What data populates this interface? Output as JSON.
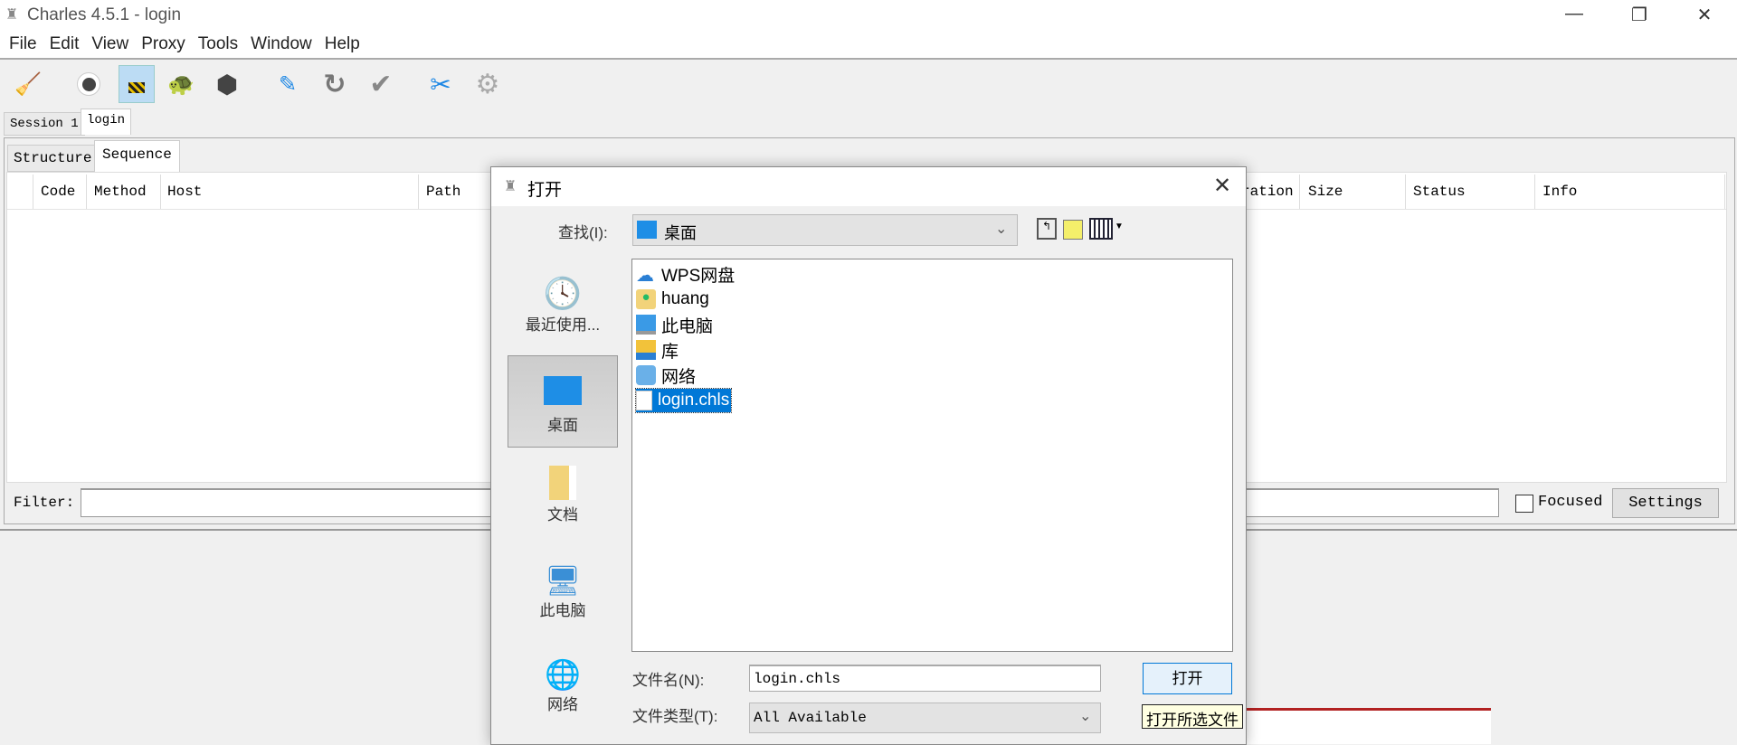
{
  "window": {
    "title": "Charles 4.5.1 - login",
    "minimize": "—",
    "maximize": "❐",
    "close": "✕"
  },
  "menu": [
    "File",
    "Edit",
    "View",
    "Proxy",
    "Tools",
    "Window",
    "Help"
  ],
  "toolbar": [
    "broom-icon",
    "record-icon",
    "ssl-lock-icon",
    "throttle-turtle-icon",
    "stop-hexagon-icon",
    "compose-pen-icon",
    "repeat-icon",
    "validate-check-icon",
    "tools-icon",
    "settings-gear-icon"
  ],
  "session_tabs": [
    "Session 1",
    "login"
  ],
  "view_tabs": [
    "Structure",
    "Sequence"
  ],
  "columns": [
    "Code",
    "Method",
    "Host",
    "Path",
    "ration",
    "Size",
    "Status",
    "Info"
  ],
  "filter": {
    "label": "Filter:",
    "value": "",
    "focused_label": "Focused",
    "focused_checked": false,
    "settings": "Settings"
  },
  "dialog": {
    "title": "打开",
    "close": "✕",
    "look_in_label": "查找(I):",
    "look_in_value": "桌面",
    "places": [
      "最近使用...",
      "桌面",
      "文档",
      "此电脑",
      "网络"
    ],
    "selected_place": "桌面",
    "files": [
      "WPS网盘",
      "huang",
      "此电脑",
      "库",
      "网络",
      "login.chls"
    ],
    "selected_file": "login.chls",
    "filename_label": "文件名(N):",
    "filename_value": "login.chls",
    "filetype_label": "文件类型(T):",
    "filetype_value": "All Available",
    "open_button": "打开",
    "tooltip": "打开所选文件"
  },
  "colors": {
    "selection": "#0078d7",
    "accent_red": "#b22222"
  }
}
